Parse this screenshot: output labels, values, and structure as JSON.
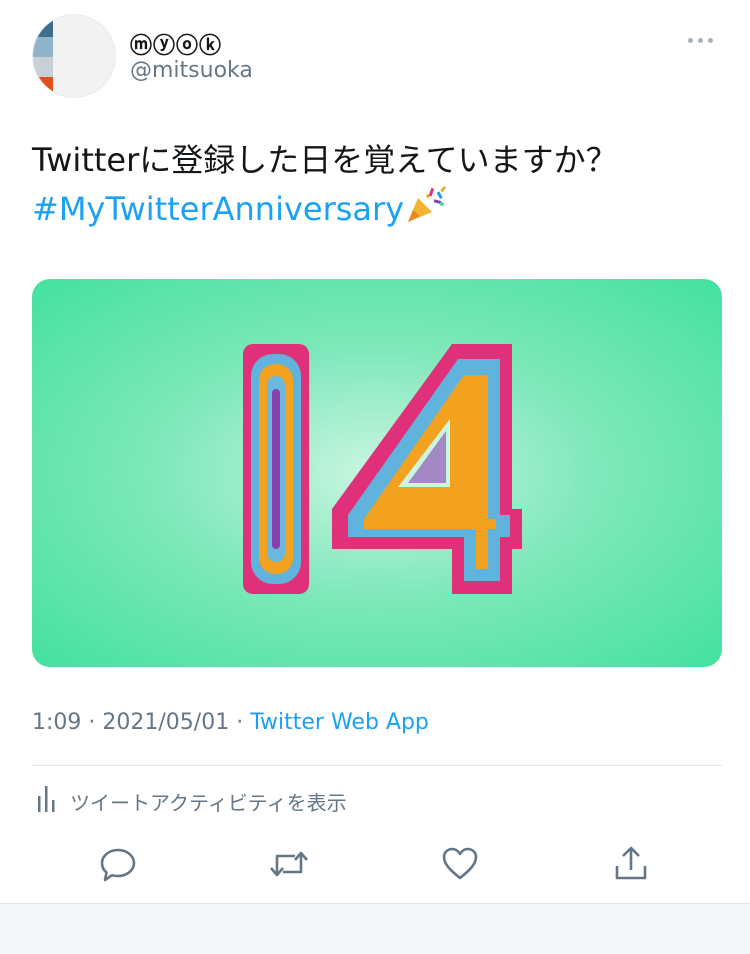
{
  "user": {
    "display_name": "ⓜⓨⓞⓚ",
    "handle": "@mitsuoka"
  },
  "tweet": {
    "text": "Twitterに登録した日を覚えていますか？",
    "hashtag": "#MyTwitterAnniversary",
    "emoji": "party-popper-icon",
    "media_number": "14",
    "time": "1:09",
    "date": "2021/05/01",
    "separator": "·",
    "source": "Twitter Web App",
    "activity_label": "ツイートアクティビティを表示"
  },
  "colors": {
    "link": "#1da1f2",
    "muted": "#657786",
    "media_green": "#43e19f",
    "digit_pink": "#e0307a",
    "digit_orange": "#f2a21f",
    "digit_blue": "#6ab8e0",
    "digit_purple": "#8a3fb0"
  },
  "actions": [
    "reply-icon",
    "retweet-icon",
    "like-icon",
    "share-icon"
  ]
}
